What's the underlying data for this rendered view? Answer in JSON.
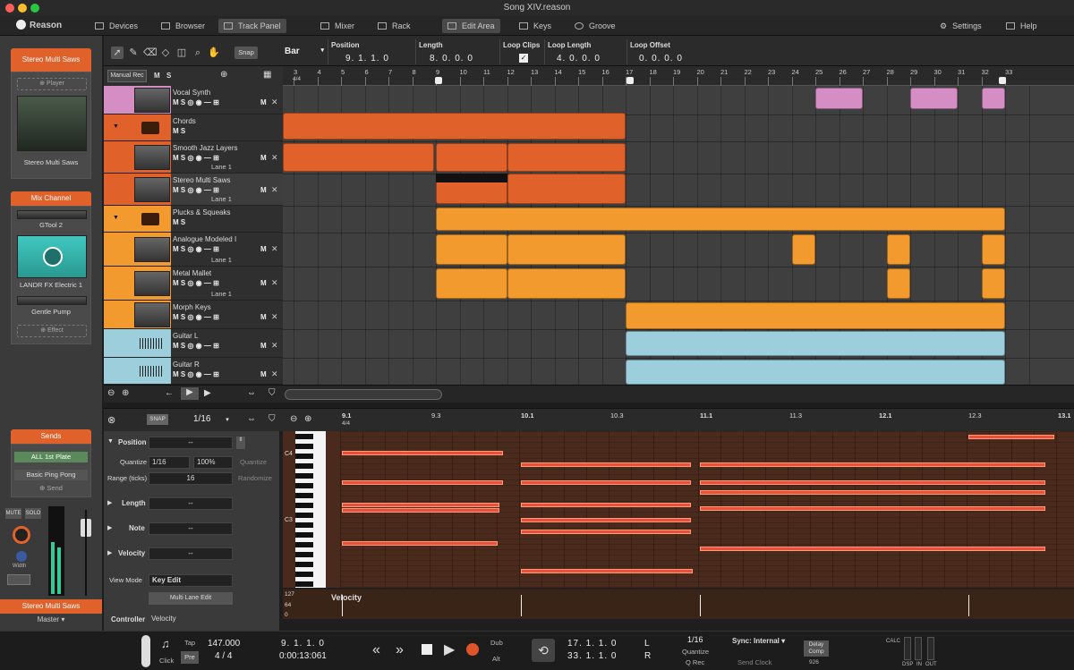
{
  "window": {
    "title": "Song XIV.reason"
  },
  "navbar": {
    "logo": "Reason",
    "devices": "Devices",
    "browser": "Browser",
    "track_panel": "Track Panel",
    "mixer": "Mixer",
    "rack": "Rack",
    "edit_area": "Edit Area",
    "keys": "Keys",
    "groove": "Groove",
    "settings": "Settings",
    "help": "Help"
  },
  "toolbar": {
    "snap": "Snap",
    "snap_value": "Bar",
    "position_label": "Position",
    "position_value": "9. 1. 1. 0",
    "length_label": "Length",
    "length_value": "8. 0. 0. 0",
    "loopclips_label": "Loop Clips",
    "looplength_label": "Loop Length",
    "looplength_value": "4. 0. 0. 0",
    "loopoffset_label": "Loop Offset",
    "loopoffset_value": "0. 0. 0. 0"
  },
  "trackheader": {
    "manual_rec": "Manual Rec",
    "m": "M",
    "s": "S",
    "time_sig": "4/4"
  },
  "ruler": {
    "ticks": [
      "3",
      "5",
      "7",
      "9",
      "11",
      "13",
      "15",
      "17",
      "19",
      "21",
      "23",
      "25",
      "27",
      "29",
      "31",
      "33"
    ],
    "small": [
      "4",
      "6",
      "8",
      "10",
      "12",
      "14",
      "16",
      "18",
      "20",
      "22",
      "24",
      "26",
      "28",
      "30",
      "32"
    ]
  },
  "tracks": [
    {
      "name": "Vocal Synth",
      "sub": "M S"
    },
    {
      "name": "Chords",
      "sub": "M S"
    },
    {
      "name": "Smooth Jazz Layers",
      "lane": "Lane 1"
    },
    {
      "name": "Stereo Multi Saws",
      "lane": "Lane 1"
    },
    {
      "name": "Plucks & Squeaks",
      "sub": "M S"
    },
    {
      "name": "Analogue Modeled I",
      "lane": "Lane 1"
    },
    {
      "name": "Metal Mallet",
      "lane": "Lane 1"
    },
    {
      "name": "Morph Keys",
      "lane": ""
    },
    {
      "name": "Guitar L",
      "lane": ""
    },
    {
      "name": "Guitar R",
      "lane": ""
    }
  ],
  "leftpanel": {
    "device_title": "Stereo Multi Saws",
    "player": "Player",
    "device_name": "Stereo Multi Saws",
    "mix_channel": "Mix Channel",
    "gtool": "GTool 2",
    "landr": "LANDR FX Electric 1",
    "gentle": "Gentle Pump",
    "effect": "Effect",
    "sends": "Sends",
    "send1": "ALL 1st Plate",
    "send2": "Basic Ping Pong",
    "send_btn": "Send",
    "mute": "MUTE",
    "solo": "SOLO",
    "width": "Width",
    "channel_name": "Stereo Multi Saws",
    "master": "Master"
  },
  "editor": {
    "snap": "SNAP",
    "quant": "1/16",
    "ruler": [
      "9.1",
      "9.3",
      "10.1",
      "10.3",
      "11.1",
      "11.3",
      "12.1",
      "12.3",
      "13.1"
    ],
    "time_sig": "4/4",
    "note_c4": "C4",
    "note_c3": "C3"
  },
  "inspector": {
    "position": "Position",
    "pos_val": "--",
    "quantize": "Quantize",
    "q_val": "1/16",
    "q_pct": "100%",
    "q_btn": "Quantize",
    "range": "Range (ticks)",
    "range_val": "16",
    "randomize": "Randomize",
    "length": "Length",
    "len_val": "--",
    "note": "Note",
    "note_val": "--",
    "velocity": "Velocity",
    "vel_val": "--",
    "viewmode": "View Mode",
    "viewmode_val": "Key Edit",
    "multilane": "Multi Lane Edit",
    "controller": "Controller",
    "controller_val": "Velocity"
  },
  "velocitylane": {
    "label": "Velocity",
    "v127": "127",
    "v64": "64",
    "v0": "0"
  },
  "transport": {
    "click": "Click",
    "tap": "Tap",
    "pre": "Pre",
    "tempo": "147.000",
    "sig": "4 / 4",
    "pos": "9. 1. 1. 0",
    "time": "0:00:13:061",
    "dub": "Dub",
    "alt": "Alt",
    "loop_l": "17. 1. 1. 0",
    "loop_r": "33. 1. 1. 0",
    "l": "L",
    "r": "R",
    "quant": "1/16",
    "quant_lbl": "Quantize",
    "qrec": "Q Rec",
    "sync": "Sync: Internal",
    "sendclock": "Send Clock",
    "delay": "Delay Comp",
    "delay_val": "926",
    "dsp": "DSP",
    "in": "IN",
    "out": "OUT",
    "calc": "CALC"
  },
  "colors": {
    "orange_dark": "#e0622a",
    "orange": "#f29a2e",
    "pink": "#d48ec4",
    "cyan": "#9ccfdb",
    "accent": "#e0622a"
  }
}
